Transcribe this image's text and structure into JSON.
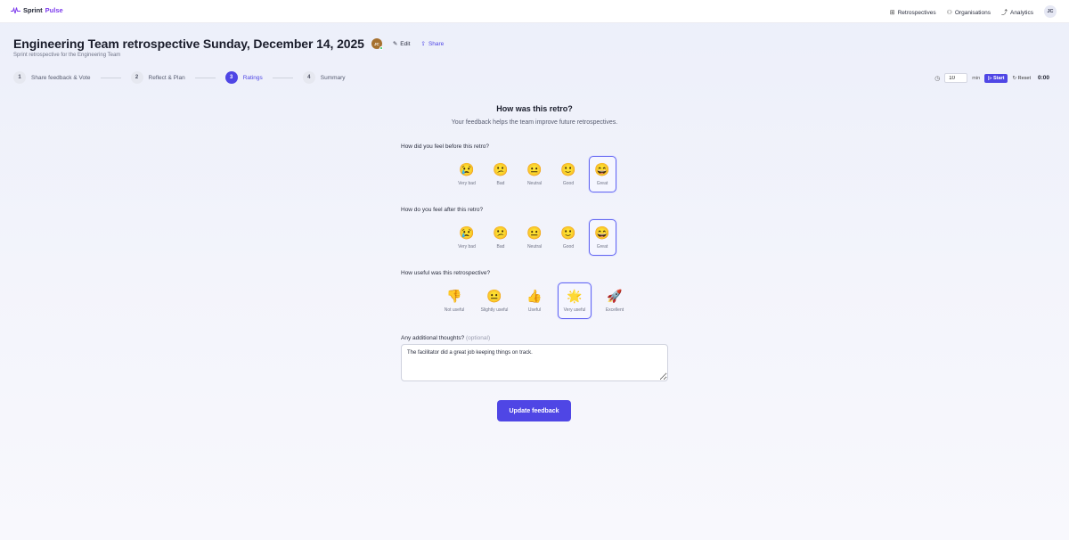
{
  "app": {
    "name_part1": "Sprint",
    "name_part2": "Pulse"
  },
  "nav": {
    "items": [
      {
        "label": "Retrospectives",
        "icon": "grid-icon"
      },
      {
        "label": "Organisations",
        "icon": "users-icon"
      },
      {
        "label": "Analytics",
        "icon": "chart-icon"
      }
    ],
    "user_initials": "JC"
  },
  "header": {
    "title": "Engineering Team retrospective Sunday, December 14, 2025",
    "owner_initials": "JC",
    "edit_label": "Edit",
    "share_label": "Share",
    "subtitle": "Sprint retrospective for the Engineering Team"
  },
  "stepper": {
    "steps": [
      {
        "num": "1",
        "label": "Share feedback & Vote",
        "active": false
      },
      {
        "num": "2",
        "label": "Reflect & Plan",
        "active": false
      },
      {
        "num": "3",
        "label": "Ratings",
        "active": true
      },
      {
        "num": "4",
        "label": "Summary",
        "active": false
      }
    ]
  },
  "timer": {
    "minutes_value": "10",
    "unit": "min",
    "start_label": "Start",
    "reset_label": "Reset",
    "display": "0:00"
  },
  "feedback": {
    "title": "How was this retro?",
    "subtitle": "Your feedback helps the team improve future retrospectives.",
    "questions": [
      {
        "label": "How did you feel before this retro?",
        "options": [
          {
            "emoji": "😢",
            "label": "Very bad"
          },
          {
            "emoji": "😕",
            "label": "Bad"
          },
          {
            "emoji": "😐",
            "label": "Neutral"
          },
          {
            "emoji": "🙂",
            "label": "Good"
          },
          {
            "emoji": "😄",
            "label": "Great"
          }
        ],
        "selected_index": 4
      },
      {
        "label": "How do you feel after this retro?",
        "options": [
          {
            "emoji": "😢",
            "label": "Very bad"
          },
          {
            "emoji": "😕",
            "label": "Bad"
          },
          {
            "emoji": "😐",
            "label": "Neutral"
          },
          {
            "emoji": "🙂",
            "label": "Good"
          },
          {
            "emoji": "😄",
            "label": "Great"
          }
        ],
        "selected_index": 4
      },
      {
        "label": "How useful was this retrospective?",
        "options": [
          {
            "emoji": "👎",
            "label": "Not useful"
          },
          {
            "emoji": "😐",
            "label": "Slightly useful"
          },
          {
            "emoji": "👍",
            "label": "Useful"
          },
          {
            "emoji": "🌟",
            "label": "Very useful"
          },
          {
            "emoji": "🚀",
            "label": "Excellent"
          }
        ],
        "selected_index": 3
      }
    ],
    "thoughts_label": "Any additional thoughts?",
    "thoughts_optional": "(optional)",
    "thoughts_value": "The facilitator did a great job keeping things on track.",
    "submit_label": "Update feedback"
  },
  "colors": {
    "accent": "#4f46e5",
    "selected_border": "#6366f1",
    "brand_pulse": "#7c3aed"
  }
}
